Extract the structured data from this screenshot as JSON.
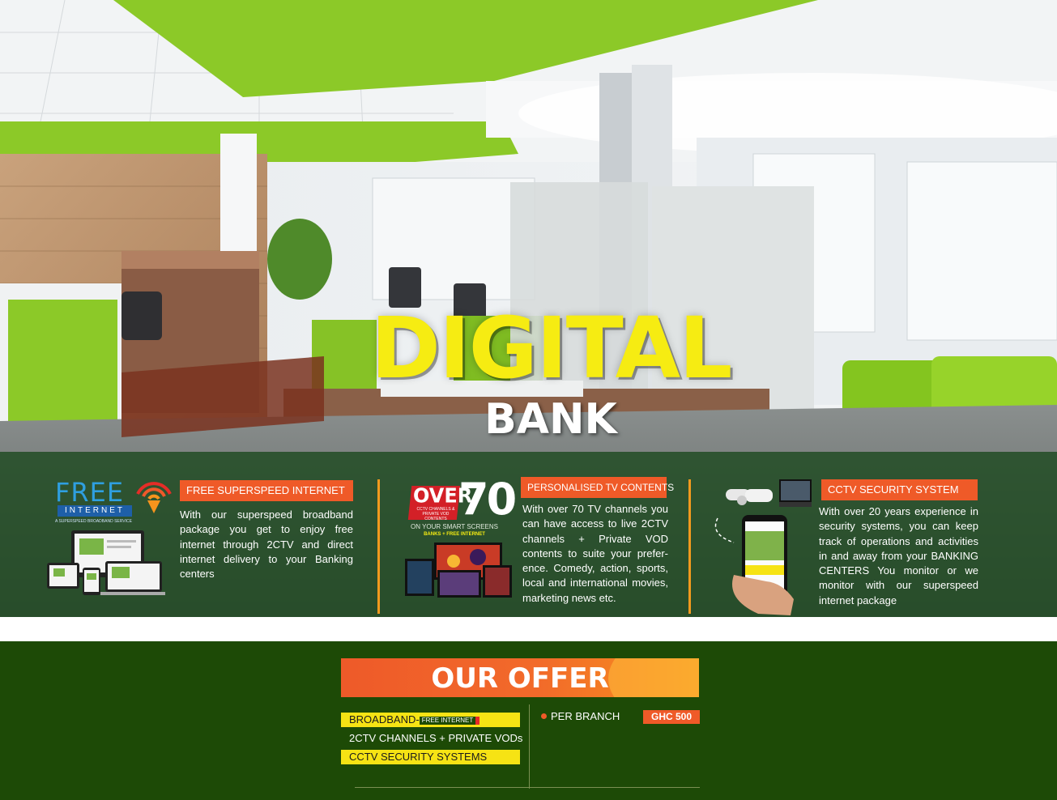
{
  "hero": {
    "title": "DIGITAL",
    "subtitle": "BANK"
  },
  "features": [
    {
      "logo_primary": "FREE",
      "logo_secondary": "INTERNET",
      "logo_caption": "A SUPERSPEED BROADBAND SERVICE",
      "tag": "FREE SUPERSPEED INTERNET",
      "description": "With our superspeed broadband package you get to enjoy free internet through 2CTV and direct internet delivery to your Banking centers",
      "icon": "devices-icon"
    },
    {
      "logo_over": "OVER",
      "logo_number": "70",
      "logo_small": "CCTV CHANNELS & PRIVATE VOD CONTENTS",
      "logo_line1": "ON YOUR SMART SCREENS",
      "logo_line2": "BANKS + FREE INTERNET",
      "tag": "PERSONALISED TV CONTENTS",
      "description": "With over 70 TV channels you can have access to live 2CTV channels + Private VOD contents to suite your prefer-ence. Comedy, action, sports, local and international movies, marketing news etc.",
      "icon": "tv-screens-icon"
    },
    {
      "tag": "CCTV SECURITY SYSTEM",
      "description": "With over 20 years experience in security systems, you can keep track of operations and activities in and away from your BANKING CENTERS You monitor or we monitor with our superspeed internet package",
      "icon": "cctv-phone-icon"
    }
  ],
  "offer": {
    "title": "OUR OFFER",
    "items": [
      {
        "label": "BROADBAND-",
        "chip": "FREE INTERNET"
      },
      {
        "label": "2CTV CHANNELS + PRIVATE VODs"
      },
      {
        "label": "CCTV SECURITY SYSTEMS"
      }
    ],
    "per_label": "PER BRANCH",
    "price": "GHC 500"
  },
  "colors": {
    "accent_orange": "#ef5a28",
    "headline_yellow": "#f6ec12",
    "band_green": "#1c481e",
    "offer_green": "#1d4a06",
    "lime": "#8cc63f"
  }
}
